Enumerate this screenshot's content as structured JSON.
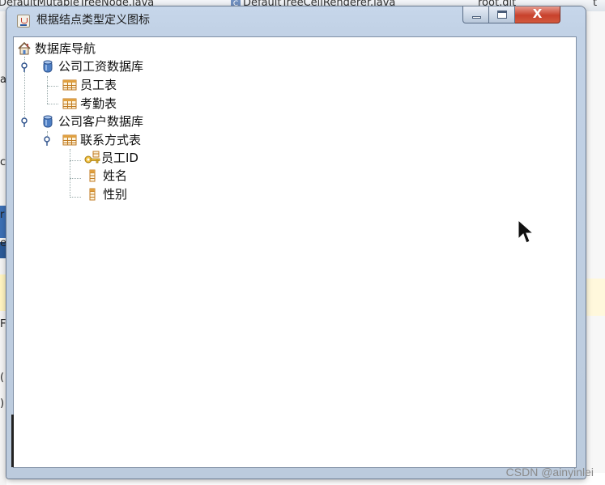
{
  "background": {
    "tabs": [
      {
        "label": "DefaultMutableTreeNode.java"
      },
      {
        "label": "DefaultTreeCellRenderer.java"
      },
      {
        "label": "root.git"
      },
      {
        "label": "t"
      }
    ],
    "left_chars": [
      "a",
      "c",
      "r",
      "e",
      "F",
      "(",
      ")"
    ]
  },
  "window": {
    "title": "根据结点类型定义图标",
    "controls": {
      "minimize": "minimize",
      "maximize": "maximize",
      "close": "X"
    }
  },
  "tree": {
    "root": {
      "label": "数据库导航",
      "icon": "home-icon"
    },
    "databases": [
      {
        "label": "公司工资数据库",
        "icon": "database-icon",
        "expanded": true,
        "tables": [
          {
            "label": "员工表",
            "icon": "table-icon"
          },
          {
            "label": "考勤表",
            "icon": "table-icon"
          }
        ]
      },
      {
        "label": "公司客户数据库",
        "icon": "database-icon",
        "expanded": true,
        "tables": [
          {
            "label": "联系方式表",
            "icon": "table-icon",
            "expanded": true,
            "columns": [
              {
                "label": "员工ID",
                "icon": "key-icon"
              },
              {
                "label": "姓名",
                "icon": "column-icon"
              },
              {
                "label": "性别",
                "icon": "column-icon"
              }
            ]
          }
        ]
      }
    ]
  },
  "watermark": "CSDN @ainyinlei",
  "colors": {
    "titlebar": "#c4d4e8",
    "close_button": "#c8412c",
    "database_icon": "#4e7fc4",
    "table_icon": "#e0a040",
    "key_icon": "#d4a017"
  }
}
